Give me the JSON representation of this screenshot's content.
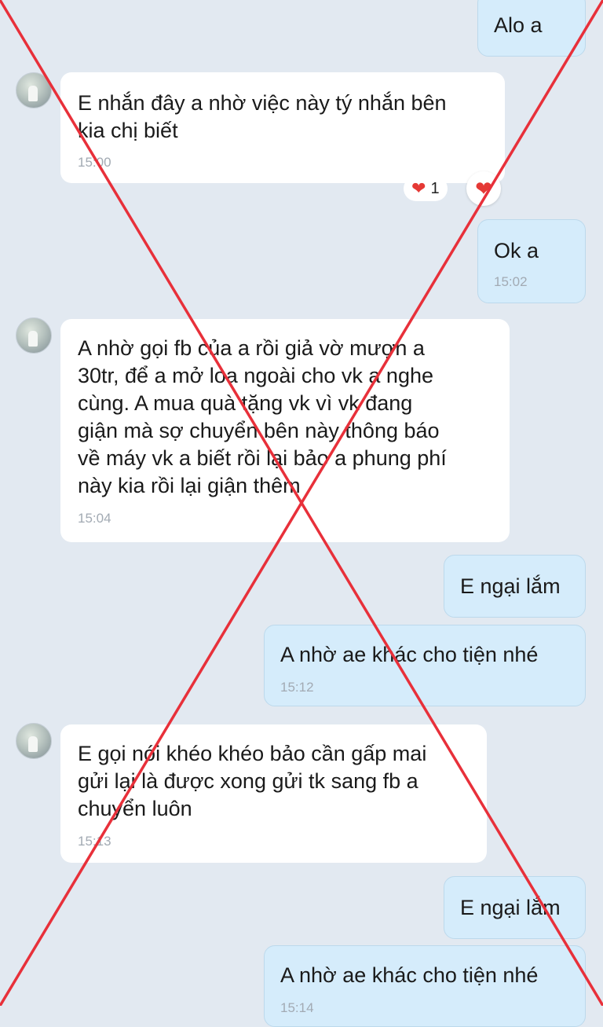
{
  "messages": [
    {
      "text": "Alo a"
    },
    {
      "text": "E nhắn đây a nhờ việc này tý nhắn bên\nkia chị biết",
      "time": "15:00",
      "reaction_count": "1"
    },
    {
      "text": "Ok a",
      "time": "15:02"
    },
    {
      "text": "A nhờ gọi fb của a rồi giả vờ mượn a\n30tr, để a mở loa ngoài cho vk a nghe\ncùng. A mua quà tặng vk vì vk đang\ngiận mà sợ chuyển bên này thông  báo\nvề máy vk a biết rồi lại bảo a phung phí\nnày kia rồi lại giận thêm",
      "time": "15:04"
    },
    {
      "text": "E ngại lắm"
    },
    {
      "text": "A nhờ ae khác cho tiện nhé",
      "time": "15:12"
    },
    {
      "text": "E gọi nói khéo khéo bảo cần gấp mai\ngửi lại là được xong gửi tk sang fb a\nchuyển luôn",
      "time": "15:13"
    },
    {
      "text": "E ngại lắm"
    },
    {
      "text": "A nhờ ae khác cho tiện nhé",
      "time": "15:14"
    }
  ],
  "icons": {
    "reaction": "heart-icon",
    "avatar": "contact-avatar"
  },
  "colors": {
    "background": "#e2e9f1",
    "incoming_bubble": "#ffffff",
    "outgoing_bubble": "#d5ecfb",
    "heart": "#e53935",
    "overlay_cross": "#e8303a"
  }
}
